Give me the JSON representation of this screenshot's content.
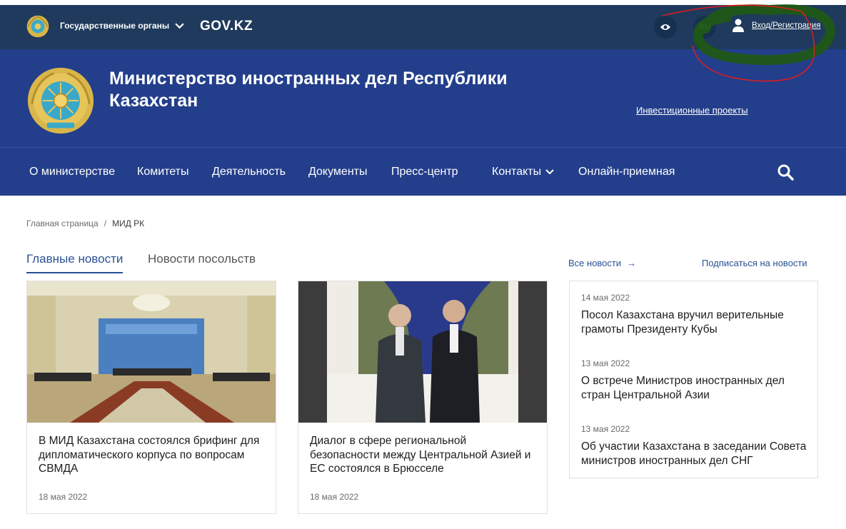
{
  "topbar": {
    "gov_menu_label": "Государственные органы",
    "brand": "GOV.KZ",
    "lang": "RU",
    "login_label": "Вход",
    "separator": "/",
    "register_label": "Регистрация",
    "icons": [
      "emblem-icon",
      "chevron-down-icon",
      "eye-icon",
      "user-icon"
    ]
  },
  "header": {
    "title": "Министерство иностранных дел Республики Казахстан",
    "invest_link": "Инвестиционные проекты"
  },
  "nav": {
    "items": [
      "О министерстве",
      "Комитеты",
      "Деятельность",
      "Документы",
      "Пресс-центр",
      "Контакты",
      "Онлайн-приемная"
    ],
    "search_icon": "search-icon"
  },
  "breadcrumb": {
    "home": "Главная страница",
    "separator": "/",
    "current": "МИД РК"
  },
  "tabs": {
    "main": "Главные новости",
    "embassy": "Новости посольств"
  },
  "links": {
    "all_news": "Все новости",
    "all_news_arrow": "→",
    "subscribe": "Подписаться на новости"
  },
  "cards": [
    {
      "title": "В МИД Казахстана состоялся брифинг для дипломатического корпуса по вопросам СВМДА",
      "date": "18 мая 2022"
    },
    {
      "title": "Диалог в сфере региональной безопасности между Центральной Азией и ЕС состоялся в Брюсселе",
      "date": "18 мая 2022"
    }
  ],
  "side_news": [
    {
      "date": "14 мая 2022",
      "title": "Посол Казахстана вручил верительные грамоты Президенту Кубы"
    },
    {
      "date": "13 мая 2022",
      "title": "О встрече Министров иностранных дел стран Центральной Азии"
    },
    {
      "date": "13 мая 2022",
      "title": "Об участии Казахстана в заседании Совета министров иностранных дел СНГ"
    }
  ],
  "colors": {
    "topbar": "#1f3a5c",
    "header": "#233e8b",
    "accent": "#2a5195",
    "emblem_gold": "#d9b54a",
    "emblem_blue": "#3aa9c9"
  }
}
